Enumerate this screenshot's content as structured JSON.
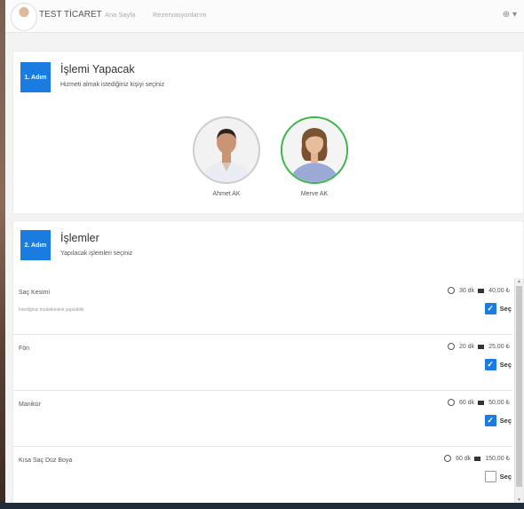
{
  "navbar": {
    "brand": "TEST TİCARET",
    "links": [
      "Ana Sayfa",
      "Rezervasyonlarım"
    ],
    "language_icon": "globe-icon",
    "language_caret": "▾"
  },
  "step1": {
    "badge": "1. Adım",
    "title": "İşlemi Yapacak",
    "subtitle": "Hizmeti almak istediğiniz kişiyi seçiniz",
    "staff": [
      {
        "name": "Ahmet AK",
        "selected": false
      },
      {
        "name": "Merve AK",
        "selected": true
      }
    ]
  },
  "step2": {
    "badge": "2. Adım",
    "title": "İşlemler",
    "subtitle": "Yapılacak işlemleri seçiniz",
    "select_label": "Seç",
    "services": [
      {
        "name": "Saç Kesimi",
        "description": "İstediğiniz modelkesimi yapılabilir",
        "duration": "30 dk",
        "price": "40,00 ₺",
        "checked": true
      },
      {
        "name": "Fön",
        "description": "",
        "duration": "20 dk",
        "price": "25,00 ₺",
        "checked": true
      },
      {
        "name": "Manikür",
        "description": "",
        "duration": "60 dk",
        "price": "50,00 ₺",
        "checked": true
      },
      {
        "name": "Kısa Saç Düz Boya",
        "description": "",
        "duration": "60 dk",
        "price": "150,00 ₺",
        "checked": false
      }
    ]
  },
  "colors": {
    "accent": "#1a7ce0",
    "selected_border": "#3bb54a"
  }
}
